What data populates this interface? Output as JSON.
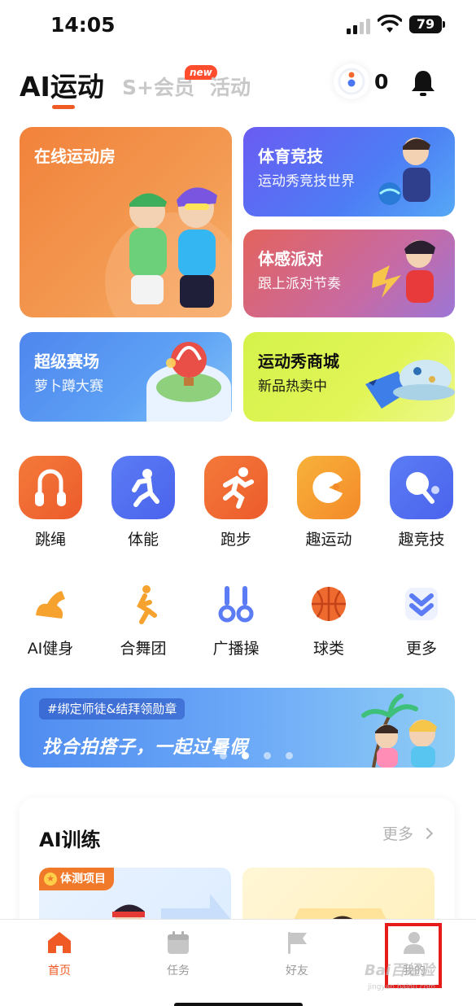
{
  "status_bar": {
    "time": "14:05",
    "battery": "79"
  },
  "header": {
    "tabs": {
      "ai_sport": "AI运动",
      "member": "S+会员",
      "activity": "活动"
    },
    "new_badge": "new",
    "energy_count": "0"
  },
  "cards": {
    "online_room": {
      "title": "在线运动房"
    },
    "sports_competition": {
      "title": "体育竞技",
      "subtitle": "运动秀竞技世界"
    },
    "motion_party": {
      "title": "体感派对",
      "subtitle": "跟上派对节奏"
    },
    "super_arena": {
      "title": "超级赛场",
      "subtitle": "萝卜蹲大赛"
    },
    "shop": {
      "title": "运动秀商城",
      "subtitle": "新品热卖中"
    }
  },
  "categories": [
    {
      "label": "跳绳",
      "icon": "jump-rope-icon"
    },
    {
      "label": "体能",
      "icon": "fitness-icon"
    },
    {
      "label": "跑步",
      "icon": "running-icon"
    },
    {
      "label": "趣运动",
      "icon": "fun-sport-icon"
    },
    {
      "label": "趣竞技",
      "icon": "ping-pong-icon"
    }
  ],
  "sub_categories": [
    {
      "label": "AI健身",
      "icon": "muscle-icon"
    },
    {
      "label": "合舞团",
      "icon": "dance-icon"
    },
    {
      "label": "广播操",
      "icon": "dumbbell-icon"
    },
    {
      "label": "球类",
      "icon": "basketball-icon"
    },
    {
      "label": "更多",
      "icon": "more-chevron-icon"
    }
  ],
  "banner": {
    "tag": "#绑定师徒&结拜领勋章",
    "text": "找合拍搭子，一起过暑假",
    "active_page": 2,
    "page_count": 4
  },
  "ai_training": {
    "title": "AI训练",
    "more": "更多",
    "badge": "体测项目"
  },
  "tabbar": {
    "items": [
      {
        "label": "首页",
        "icon": "home-icon",
        "active": true
      },
      {
        "label": "任务",
        "icon": "calendar-icon",
        "active": false
      },
      {
        "label": "好友",
        "icon": "flag-icon",
        "active": false
      },
      {
        "label": "我的",
        "icon": "profile-icon",
        "active": false
      }
    ]
  },
  "watermark": {
    "main": "Bai百经验",
    "sub": "jingyan.baidu.com"
  },
  "colors": {
    "accent": "#f05a24",
    "highlight_box": "#e81b1b"
  }
}
